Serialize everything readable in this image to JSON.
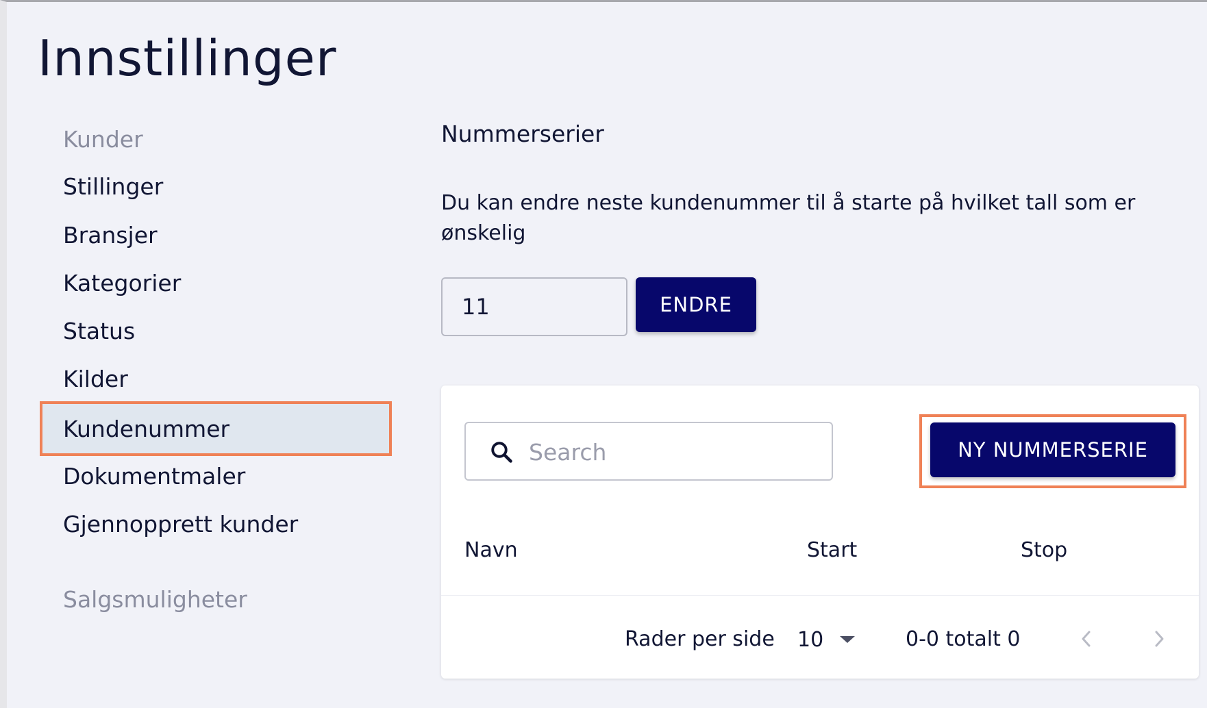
{
  "page": {
    "title": "Innstillinger"
  },
  "sidebar": {
    "sections": [
      {
        "label": "Kunder",
        "items": [
          {
            "label": "Stillinger",
            "active": false
          },
          {
            "label": "Bransjer",
            "active": false
          },
          {
            "label": "Kategorier",
            "active": false
          },
          {
            "label": "Status",
            "active": false
          },
          {
            "label": "Kilder",
            "active": false
          },
          {
            "label": "Kundenummer",
            "active": true
          },
          {
            "label": "Dokumentmaler",
            "active": false
          },
          {
            "label": "Gjennopprett kunder",
            "active": false
          }
        ]
      },
      {
        "label": "Salgsmuligheter",
        "items": []
      }
    ]
  },
  "main": {
    "section_title": "Nummerserier",
    "description": "Du kan endre neste kundenummer til å starte på hvilket tall som er ønskelig",
    "next_number_value": "11",
    "change_button_label": "ENDRE",
    "search": {
      "placeholder": "Search"
    },
    "new_series_button_label": "NY NUMMERSERIE",
    "table": {
      "columns": [
        "Navn",
        "Start",
        "Stop"
      ],
      "rows": []
    },
    "pagination": {
      "rows_per_page_label": "Rader per side",
      "rows_per_page_value": "10",
      "range_text": "0-0 totalt 0"
    }
  },
  "colors": {
    "background": "#f1f2f8",
    "primary": "#07076b",
    "highlight": "#ef8156",
    "active_item_bg": "#e0e7ef",
    "text": "#111634",
    "muted_text": "#8a8d9f"
  },
  "icons": {
    "search": "search-icon",
    "rows_dropdown": "caret-down-icon",
    "prev": "chevron-left-icon",
    "next": "chevron-right-icon"
  }
}
